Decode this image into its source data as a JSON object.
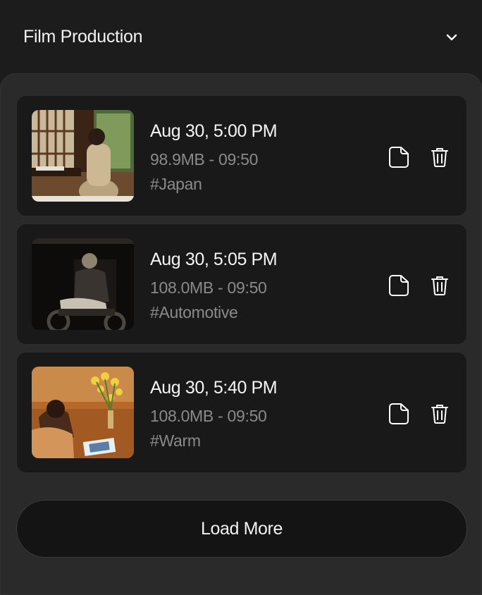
{
  "header": {
    "title": "Film Production",
    "toggle_icon": "chevron-down-icon"
  },
  "items": [
    {
      "date": "Aug 30, 5:00 PM",
      "meta": "98.9MB - 09:50",
      "tag": "#Japan"
    },
    {
      "date": "Aug 30, 5:05 PM",
      "meta": "108.0MB - 09:50",
      "tag": "#Automotive"
    },
    {
      "date": "Aug 30, 5:40 PM",
      "meta": "108.0MB - 09:50",
      "tag": "#Warm"
    }
  ],
  "actions": {
    "folder_icon": "folder-icon",
    "trash_icon": "trash-icon"
  },
  "load_more": {
    "label": "Load More"
  },
  "colors": {
    "background": "#1c1c1c",
    "panel": "#2a2a2a",
    "card": "#191919",
    "muted_text": "#8a8a8a"
  }
}
